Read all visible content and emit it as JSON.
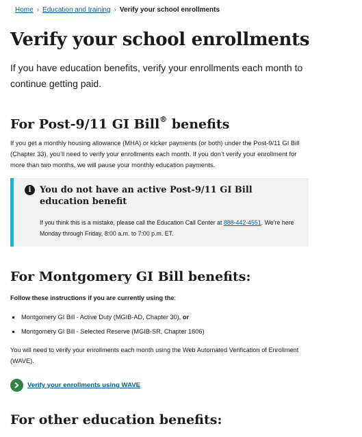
{
  "breadcrumb": {
    "home": "Home",
    "education": "Education and training",
    "current": "Verify your school enrollments"
  },
  "page": {
    "title": "Verify your school enrollments",
    "intro": "If you have education benefits, verify your enrollments each month to continue getting paid."
  },
  "post911": {
    "heading": "For Post-9/11 GI Bill",
    "heading_mark": "®",
    "heading_suffix": " benefits",
    "body": "If you get a monthly housing allowance (MHA) or kicker payments (or both) under the Post-9/11 GI Bill (Chapter 33), you’ll need to verify your enrollments each month. If you don’t verify your enrollment for more than two months, we will pause your monthly education payments.",
    "alert": {
      "icon": "info-icon",
      "title": "You do not have an active Post-9/11 GI Bill education benefit",
      "text_before": "If you think this is a mistake, please call the Education Call Center at ",
      "phone": "888-442-4551",
      "text_after": ". We’re here Monday through Friday, 8:00 a.m. to 7:00 p.m. ET."
    }
  },
  "mgib": {
    "heading": "For Montgomery GI Bill benefits:",
    "lead_bold": "Follow these instructions if you are currently using the",
    "lead_tail": ":",
    "items": [
      {
        "text": "Montgomery GI Bill - Active Duty (MGIB-AD, Chapter 30), ",
        "suffix": "or"
      },
      {
        "text": "Montgomery GI Bill - Selected Reserve (MGIB-SR, Chapter 1606)",
        "suffix": ""
      }
    ],
    "wave_text": "You will need to verify your enrollments each month using the Web Automated Verification of Enrollment (WAVE).",
    "action_link": "Verify your enrollments using WAVE"
  },
  "other": {
    "heading": "For other education benefits:"
  },
  "colors": {
    "link": "#005ea2",
    "alert_border": "#00bde3",
    "alert_bg": "#f1f1f1",
    "action_green": "#2e8540"
  }
}
